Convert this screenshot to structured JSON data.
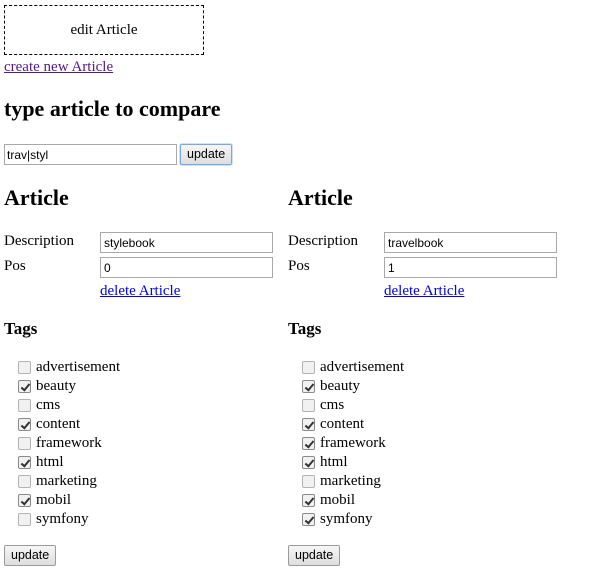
{
  "edit_box": {
    "label": "edit Article"
  },
  "create_link": "create new Article",
  "compare": {
    "heading": "type article to compare",
    "input_value": "trav|styl",
    "update_label": "update"
  },
  "articles": [
    {
      "title": "Article",
      "description_label": "Description",
      "description_value": "stylebook",
      "pos_label": "Pos",
      "pos_value": "0",
      "delete_label": "delete Article",
      "tags_title": "Tags",
      "tags": [
        {
          "name": "advertisement",
          "checked": false
        },
        {
          "name": "beauty",
          "checked": true
        },
        {
          "name": "cms",
          "checked": false
        },
        {
          "name": "content",
          "checked": true
        },
        {
          "name": "framework",
          "checked": false
        },
        {
          "name": "html",
          "checked": true
        },
        {
          "name": "marketing",
          "checked": false
        },
        {
          "name": "mobil",
          "checked": true
        },
        {
          "name": "symfony",
          "checked": false
        }
      ],
      "update_label": "update"
    },
    {
      "title": "Article",
      "description_label": "Description",
      "description_value": "travelbook",
      "pos_label": "Pos",
      "pos_value": "1",
      "delete_label": "delete Article",
      "tags_title": "Tags",
      "tags": [
        {
          "name": "advertisement",
          "checked": false
        },
        {
          "name": "beauty",
          "checked": true
        },
        {
          "name": "cms",
          "checked": false
        },
        {
          "name": "content",
          "checked": true
        },
        {
          "name": "framework",
          "checked": true
        },
        {
          "name": "html",
          "checked": true
        },
        {
          "name": "marketing",
          "checked": false
        },
        {
          "name": "mobil",
          "checked": true
        },
        {
          "name": "symfony",
          "checked": true
        }
      ],
      "update_label": "update"
    }
  ]
}
